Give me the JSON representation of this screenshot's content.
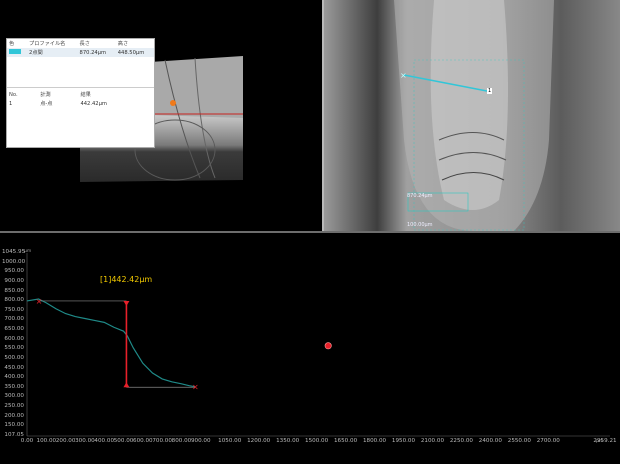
{
  "info_panel": {
    "headers": [
      "色",
      "プロファイル名",
      "長さ",
      "高さ"
    ],
    "profile_row": {
      "name": "2点間",
      "length": "870.24µm",
      "height": "448.50µm"
    },
    "measure_headers": [
      "No.",
      "計測",
      "結果"
    ],
    "measure_row": {
      "no": "1",
      "type": "点-点",
      "result": "442.42µm"
    }
  },
  "camera": {
    "marker_label": "1",
    "scale_label_1": "870.24µm",
    "scale_label_2": "100.00µm",
    "line_color": "#31c6d8"
  },
  "graph": {
    "unit_y": "µm",
    "unit_x": "µm",
    "measurement_label": "[1]442.42µm",
    "y_ticks": [
      "1045.95",
      "1000.00",
      "950.00",
      "900.00",
      "850.00",
      "800.00",
      "750.00",
      "700.00",
      "650.00",
      "600.00",
      "550.00",
      "500.00",
      "450.00",
      "400.00",
      "350.00",
      "300.00",
      "250.00",
      "200.00",
      "150.00",
      "107.05"
    ],
    "x_ticks": [
      "0.00",
      "100.00",
      "200.00",
      "300.00",
      "400.00",
      "500.00",
      "600.00",
      "700.00",
      "800.00",
      "900.00",
      "1050.00",
      "1200.00",
      "1350.00",
      "1500.00",
      "1650.00",
      "1800.00",
      "1950.00",
      "2100.00",
      "2250.00",
      "2400.00",
      "2550.00",
      "2700.00",
      "2959.21"
    ]
  },
  "chart_data": {
    "type": "line",
    "xlabel": "µm",
    "ylabel": "µm",
    "xlim": [
      0,
      2959.21
    ],
    "ylim": [
      107.05,
      1045.95
    ],
    "series": [
      {
        "x": [
          0,
          60,
          100,
          150,
          200,
          250,
          300,
          350,
          400,
          450,
          500,
          520,
          550,
          600,
          650,
          700,
          750,
          800,
          840,
          870
        ],
        "y": [
          800,
          810,
          790,
          760,
          735,
          720,
          710,
          700,
          690,
          665,
          645,
          620,
          560,
          480,
          430,
          400,
          385,
          375,
          365,
          360
        ]
      }
    ],
    "markers": [
      {
        "x": 60,
        "y": 800,
        "shape": "x"
      },
      {
        "x": 870,
        "y": 360,
        "shape": "x"
      },
      {
        "x": 1560,
        "y": 570,
        "shape": "dot"
      }
    ],
    "measurement": {
      "label": "[1]442.42µm",
      "x": 515,
      "y_top": 800,
      "y_bottom": 357
    },
    "grid": false,
    "colors": {
      "line": "#1f8a88",
      "measure": "#e8202a",
      "marker": "#e8202a"
    }
  }
}
